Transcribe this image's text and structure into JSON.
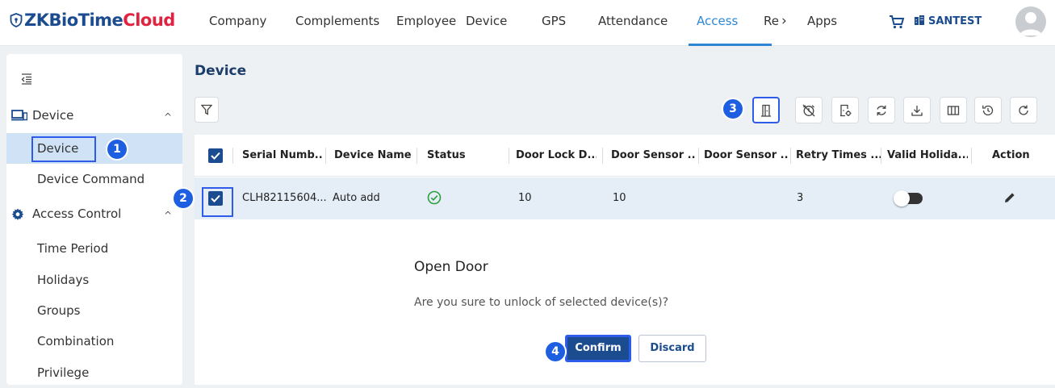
{
  "logo": {
    "part1": "ZKBioTime",
    "part2": "Cloud"
  },
  "nav": {
    "items": [
      "Company",
      "Complements",
      "Employee",
      "Device",
      "GPS",
      "Attendance",
      "Access",
      "Re",
      "Apps"
    ],
    "more": "›",
    "active": "Access"
  },
  "account": {
    "tenant": "SANTEST"
  },
  "sidebar": {
    "groups": [
      {
        "label": "Device",
        "chevron": "^",
        "items": [
          "Device",
          "Device Command"
        ],
        "selected": "Device"
      },
      {
        "label": "Access Control",
        "chevron": "^",
        "items": [
          "Time Period",
          "Holidays",
          "Groups",
          "Combination",
          "Privilege"
        ]
      }
    ]
  },
  "page": {
    "title": "Device"
  },
  "toolbar": {
    "buttons": [
      "open-door-icon",
      "alarm-off-icon",
      "door-settings-icon",
      "sync-icon",
      "download-icon",
      "columns-icon",
      "history-icon",
      "refresh-icon"
    ]
  },
  "table": {
    "columns": [
      "Serial Numb...",
      "Device Name",
      "Status",
      "Door Lock D...",
      "Door Sensor ...",
      "Door Sensor ...",
      "Retry Times ...",
      "Valid Holida...",
      "Action"
    ],
    "rows": [
      {
        "serial": "CLH82115604...",
        "name": "Auto add",
        "status": "online",
        "door_lock": "10",
        "door_sensor": "10",
        "door_sensor_2": "",
        "retry_times": "3",
        "valid_holidays": false
      }
    ]
  },
  "dialog": {
    "title": "Open Door",
    "message": "Are you sure to unlock of selected device(s)?",
    "confirm": "Confirm",
    "discard": "Discard"
  },
  "annotations": {
    "step1": "1",
    "step2": "2",
    "step3": "3",
    "step4": "4"
  },
  "colors": {
    "brand": "#1a4c8f",
    "brand_red": "#e0233f",
    "accent": "#2f86d3",
    "highlight": "#2f5bea",
    "status_ok": "#2e9e3e"
  }
}
